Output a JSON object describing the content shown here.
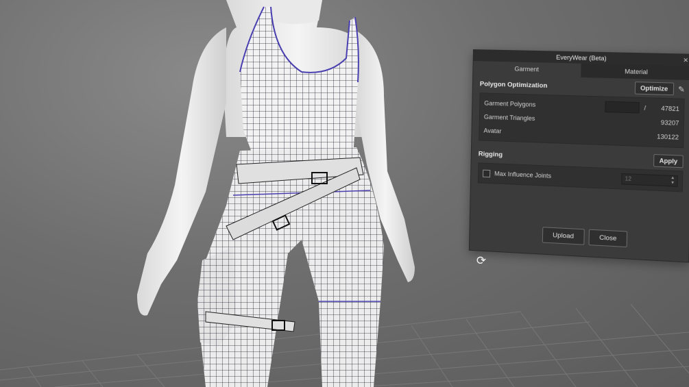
{
  "window": {
    "title": "EveryWear (Beta)",
    "close_icon": "close-icon"
  },
  "tabs": [
    {
      "label": "Garment",
      "active": true
    },
    {
      "label": "Material",
      "active": false
    }
  ],
  "polygon_optimization": {
    "heading": "Polygon Optimization",
    "optimize_label": "Optimize",
    "edit_icon": "pencil-icon",
    "rows": [
      {
        "label": "Garment Polygons",
        "input_value": "",
        "separator": "/",
        "value": "47821"
      },
      {
        "label": "Garment Triangles",
        "value": "93207"
      },
      {
        "label": "Avatar",
        "value": "130122"
      }
    ]
  },
  "rigging": {
    "heading": "Rigging",
    "apply_label": "Apply",
    "max_influence_label": "Max Influence Joints",
    "max_influence_checked": false,
    "max_influence_value": "12"
  },
  "footer": {
    "upload_label": "Upload",
    "close_label": "Close"
  },
  "viewport": {
    "refresh_icon": "refresh-icon"
  },
  "colors": {
    "panel_bg": "#3b3b3b",
    "mesh_line": "#1c1c2a",
    "seam": "#4a3fb0"
  }
}
